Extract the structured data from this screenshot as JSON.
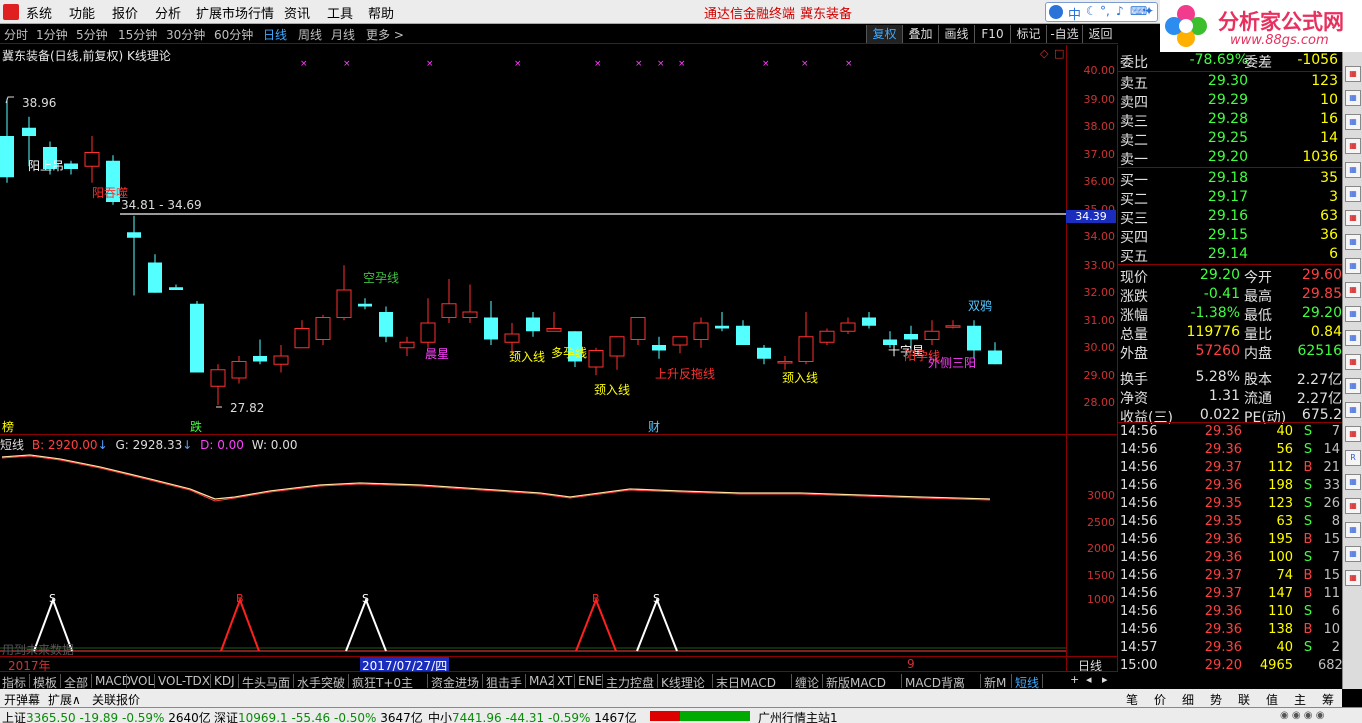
{
  "menu": {
    "items": [
      "系统",
      "功能",
      "报价",
      "分析",
      "扩展市场行情",
      "资讯",
      "工具",
      "帮助"
    ],
    "center_a": "通达信金融终端",
    "center_b": "冀东装备",
    "search_tags": [
      "中",
      "",
      "",
      "",
      "",
      "",
      ""
    ]
  },
  "logo": {
    "text": "分析家公式网",
    "url": "www.88gs.com"
  },
  "periods": [
    "分时",
    "1分钟",
    "5分钟",
    "15分钟",
    "30分钟",
    "60分钟",
    "日线",
    "周线",
    "月线",
    "更多 >"
  ],
  "selected_period": "日线",
  "toolbar": [
    "复权",
    "叠加",
    "画线",
    "F10",
    "标记",
    "-自选",
    "返回"
  ],
  "stock_title": "冀东装备(日线,前复权) K线理论",
  "price_axis": [
    "40.00",
    "39.00",
    "38.00",
    "37.00",
    "36.00",
    "35.00",
    "34.00",
    "33.00",
    "32.00",
    "31.00",
    "30.00",
    "29.00",
    "28.00"
  ],
  "current_price_tag": "34.39",
  "hline_label": "34.81 - 34.69",
  "high_label": "38.96",
  "low_label": "27.82",
  "patterns": [
    "阳上吊",
    "阳吞噬",
    "空孕线",
    "晨星",
    "颈入线",
    "多孕线",
    "颈入线",
    "上升反拖线",
    "颈入线",
    "十字星",
    "阳孕线",
    "外侧三阳",
    "双鸦"
  ],
  "events": [
    "榜",
    "跌",
    "财"
  ],
  "indicator": {
    "name": "短线",
    "b_label": "B: 2920.00",
    "g_label": "G: 2928.33",
    "d_label": "D: 0.00",
    "w_label": "W: 0.00",
    "axis": [
      "3000",
      "2500",
      "2000",
      "1500",
      "1000"
    ],
    "signals": [
      "S",
      "B",
      "S",
      "B",
      "S"
    ]
  },
  "future_note": "用到未来数据",
  "date_bar": {
    "year": "2017年",
    "cursor_date": "2017/07/27/四",
    "mark": "9",
    "right": "日线"
  },
  "quote": {
    "wb": {
      "label": "委比",
      "value": "-78.69%",
      "label2": "委差",
      "value2": "-1056"
    },
    "asks": [
      {
        "label": "卖五",
        "price": "29.30",
        "vol": "123"
      },
      {
        "label": "卖四",
        "price": "29.29",
        "vol": "10"
      },
      {
        "label": "卖三",
        "price": "29.28",
        "vol": "16"
      },
      {
        "label": "卖二",
        "price": "29.25",
        "vol": "14"
      },
      {
        "label": "卖一",
        "price": "29.20",
        "vol": "1036"
      }
    ],
    "bids": [
      {
        "label": "买一",
        "price": "29.18",
        "vol": "35"
      },
      {
        "label": "买二",
        "price": "29.17",
        "vol": "3"
      },
      {
        "label": "买三",
        "price": "29.16",
        "vol": "63"
      },
      {
        "label": "买四",
        "price": "29.15",
        "vol": "36"
      },
      {
        "label": "买五",
        "price": "29.14",
        "vol": "6"
      }
    ],
    "stats": [
      {
        "l1": "现价",
        "v1": "29.20",
        "c1": "dn",
        "l2": "今开",
        "v2": "29.60",
        "c2": "up"
      },
      {
        "l1": "涨跌",
        "v1": "-0.41",
        "c1": "dn",
        "l2": "最高",
        "v2": "29.85",
        "c2": "up"
      },
      {
        "l1": "涨幅",
        "v1": "-1.38%",
        "c1": "dn",
        "l2": "最低",
        "v2": "29.20",
        "c2": "dn"
      },
      {
        "l1": "总量",
        "v1": "119776",
        "c1": "yl",
        "l2": "量比",
        "v2": "0.84",
        "c2": "yl"
      },
      {
        "l1": "外盘",
        "v1": "57260",
        "c1": "up",
        "l2": "内盘",
        "v2": "62516",
        "c2": "dn"
      },
      {
        "l1": "换手",
        "v1": "5.28%",
        "c1": "wh",
        "l2": "股本",
        "v2": "2.27亿",
        "c2": "wh"
      },
      {
        "l1": "净资",
        "v1": "1.31",
        "c1": "wh",
        "l2": "流通",
        "v2": "2.27亿",
        "c2": "wh"
      },
      {
        "l1": "收益(三)",
        "v1": "0.022",
        "c1": "wh",
        "l2": "PE(动)",
        "v2": "675.2",
        "c2": "wh"
      }
    ],
    "ticks": [
      {
        "t": "14:56",
        "p": "29.36",
        "v": "40",
        "f": "S",
        "n": "7"
      },
      {
        "t": "14:56",
        "p": "29.36",
        "v": "56",
        "f": "S",
        "n": "14"
      },
      {
        "t": "14:56",
        "p": "29.37",
        "v": "112",
        "f": "B",
        "n": "21"
      },
      {
        "t": "14:56",
        "p": "29.36",
        "v": "198",
        "f": "S",
        "n": "33"
      },
      {
        "t": "14:56",
        "p": "29.35",
        "v": "123",
        "f": "S",
        "n": "26"
      },
      {
        "t": "14:56",
        "p": "29.35",
        "v": "63",
        "f": "S",
        "n": "8"
      },
      {
        "t": "14:56",
        "p": "29.36",
        "v": "195",
        "f": "B",
        "n": "15"
      },
      {
        "t": "14:56",
        "p": "29.36",
        "v": "100",
        "f": "S",
        "n": "7"
      },
      {
        "t": "14:56",
        "p": "29.37",
        "v": "74",
        "f": "B",
        "n": "15"
      },
      {
        "t": "14:56",
        "p": "29.37",
        "v": "147",
        "f": "B",
        "n": "11"
      },
      {
        "t": "14:56",
        "p": "29.36",
        "v": "110",
        "f": "S",
        "n": "6"
      },
      {
        "t": "14:56",
        "p": "29.36",
        "v": "138",
        "f": "B",
        "n": "10"
      },
      {
        "t": "14:57",
        "p": "29.36",
        "v": "40",
        "f": "S",
        "n": "2"
      },
      {
        "t": "15:00",
        "p": "29.20",
        "v": "4965",
        "f": "",
        "n": "682"
      }
    ]
  },
  "bottom_tabs": [
    "指标",
    "模板",
    "全部",
    "MACD",
    "VOL",
    "VOL-TDX",
    "KDJ",
    "牛头马面",
    "水手突破",
    "疯狂T+0主",
    "资金进场",
    "狙击手",
    "MA2",
    "XT",
    "ENE",
    "主力控盘",
    "K线理论",
    "末日MACD",
    "缠论",
    "新版MACD",
    "MACD背离",
    "新M",
    "短线"
  ],
  "selected_bottom_tab": "短线",
  "bottom_tabs2": [
    "开弹幕",
    "扩展∧",
    "关联报价"
  ],
  "right_tabs": [
    "笔",
    "价",
    "细",
    "势",
    "联",
    "值",
    "主",
    "筹"
  ],
  "status": {
    "sh_label": "上证",
    "sh": "3365.50",
    "sh_chg": "-19.89",
    "sh_pct": "-0.59%",
    "sh_amt": "2640亿",
    "sz_label": "深证",
    "sz": "10969.1",
    "sz_chg": "-55.46",
    "sz_pct": "-0.50%",
    "sz_amt": "3647亿",
    "zx_label": "中小",
    "zx": "7441.96",
    "zx_chg": "-44.31",
    "zx_pct": "-0.59%",
    "zx_amt": "1467亿",
    "server": "广州行情主站1"
  },
  "colors": {
    "up": "#ff4040",
    "down": "#40ff40",
    "cyan": "#54ffff",
    "axis_red": "#cc3333"
  }
}
